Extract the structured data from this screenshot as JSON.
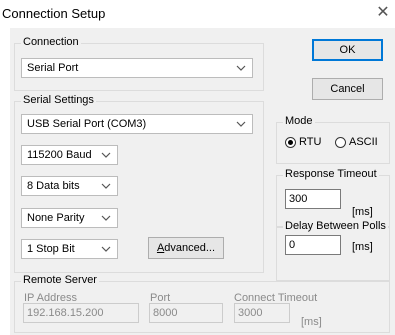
{
  "window": {
    "title": "Connection Setup",
    "close_glyph": "✕"
  },
  "connection": {
    "group_label": "Connection",
    "selected": "Serial Port"
  },
  "buttons": {
    "ok": "OK",
    "cancel": "Cancel",
    "advanced_prefix": "A",
    "advanced_rest": "dvanced..."
  },
  "serial": {
    "group_label": "Serial Settings",
    "port": "USB Serial Port (COM3)",
    "baud": "115200 Baud",
    "data_bits": "8 Data bits",
    "parity": "None Parity",
    "stop_bits": "1 Stop Bit"
  },
  "mode": {
    "group_label": "Mode",
    "options": [
      {
        "label": "RTU",
        "selected": true
      },
      {
        "label": "ASCII",
        "selected": false
      }
    ]
  },
  "response_timeout": {
    "group_label": "Response Timeout",
    "value": "300",
    "unit": "[ms]"
  },
  "delay_between_polls": {
    "group_label": "Delay Between Polls",
    "value": "0",
    "unit": "[ms]"
  },
  "remote_server": {
    "group_label": "Remote Server",
    "ip_label": "IP Address",
    "ip_value": "192.168.15.200",
    "port_label": "Port",
    "port_value": "8000",
    "timeout_label": "Connect Timeout",
    "timeout_value": "3000",
    "timeout_unit": "[ms]"
  },
  "icons": {
    "chevron": "chevron-down-icon"
  },
  "colors": {
    "focus_border": "#0078d7",
    "dialog_bg": "#f0f0f0"
  }
}
